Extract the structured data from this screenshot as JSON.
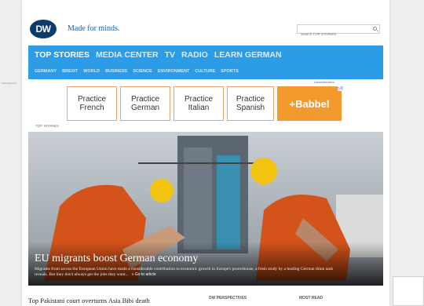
{
  "header": {
    "logo_text": "DW",
    "tagline": "Made for minds.",
    "search_placeholder": "Search TOP STORIES"
  },
  "nav": {
    "primary": [
      "TOP STORIES",
      "MEDIA CENTER",
      "TV",
      "RADIO",
      "LEARN GERMAN"
    ],
    "secondary": [
      "GERMANY",
      "BREXIT",
      "WORLD",
      "BUSINESS",
      "SCIENCE",
      "ENVIRONMENT",
      "CULTURE",
      "SPORTS"
    ]
  },
  "ad": {
    "label": "Advertisement",
    "side_label": "Advertisement",
    "tiles": [
      {
        "line1": "Practice",
        "line2": "French"
      },
      {
        "line1": "Practice",
        "line2": "German"
      },
      {
        "line1": "Practice",
        "line2": "Italian"
      },
      {
        "line1": "Practice",
        "line2": "Spanish"
      }
    ],
    "brand": "+Babbel",
    "choice_label": "▷X"
  },
  "section_label": "TOP STORIES",
  "hero": {
    "headline": "EU migrants boost German economy",
    "summary": "Migrants from across the European Union have made a considerable contribution to economic growth in Europe's powerhouse, a fresh study by a leading German think tank reveals. But they don't always get the jobs they want...",
    "link": "» Go to article"
  },
  "bottom": {
    "story": "Top Pakistani court overturns Asia Bibi death",
    "col2": "DW PERSPECTIVES",
    "col3": "MOST READ"
  }
}
